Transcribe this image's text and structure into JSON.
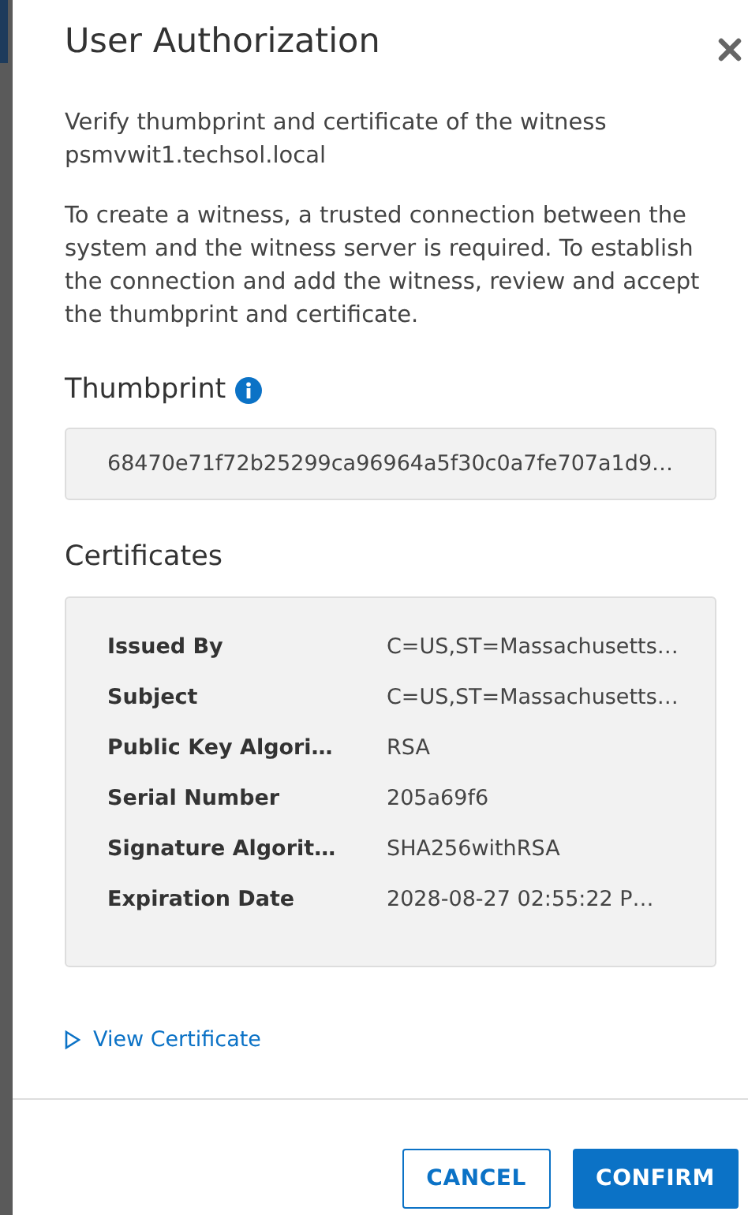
{
  "dialog": {
    "title": "User Authorization",
    "subtitle": "Verify thumbprint and certificate of the witness psmvwit1.techsol.local",
    "description": "To create a witness, a trusted connection between the system and the witness server is required. To establish the connection and add the witness, review and accept the thumbprint and certificate."
  },
  "thumbprint": {
    "heading": "Thumbprint",
    "value": "68470e71f72b25299ca96964a5f30c0a7fe707a1d9…"
  },
  "certificates": {
    "heading": "Certificates",
    "rows": [
      {
        "label": "Issued By",
        "value": "C=US,ST=Massachusetts…"
      },
      {
        "label": "Subject",
        "value": "C=US,ST=Massachusetts…"
      },
      {
        "label": "Public Key Algori…",
        "value": "RSA"
      },
      {
        "label": "Serial Number",
        "value": "205a69f6"
      },
      {
        "label": "Signature Algorit…",
        "value": "SHA256withRSA"
      },
      {
        "label": "Expiration Date",
        "value": "2028-08-27 02:55:22 P…"
      }
    ]
  },
  "view_certificate": {
    "label": "View Certificate",
    "expanded": false
  },
  "buttons": [
    {
      "label": "CANCEL",
      "kind": "secondary"
    },
    {
      "label": "CONFIRM",
      "kind": "primary"
    }
  ]
}
